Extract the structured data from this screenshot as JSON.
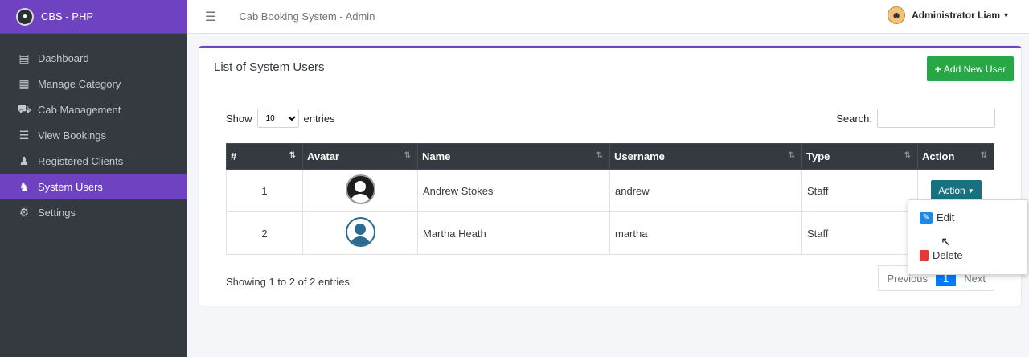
{
  "brand": {
    "name": "CBS - PHP"
  },
  "topbar": {
    "title": "Cab Booking System - Admin",
    "user": "Administrator Liam"
  },
  "sidebar": {
    "items": [
      {
        "label": "Dashboard",
        "icon": "dashboard-icon"
      },
      {
        "label": "Manage Category",
        "icon": "grid-icon"
      },
      {
        "label": "Cab Management",
        "icon": "car-icon"
      },
      {
        "label": "View Bookings",
        "icon": "list-icon"
      },
      {
        "label": "Registered Clients",
        "icon": "users-icon"
      },
      {
        "label": "System Users",
        "icon": "user-gear-icon",
        "active": true
      },
      {
        "label": "Settings",
        "icon": "cogs-icon"
      }
    ]
  },
  "card": {
    "title": "List of System Users",
    "add_button": "Add New User"
  },
  "table_controls": {
    "show_label": "Show",
    "entries_value": "10",
    "entries_label": "entries",
    "search_label": "Search:",
    "search_value": ""
  },
  "table": {
    "headers": [
      "#",
      "Avatar",
      "Name",
      "Username",
      "Type",
      "Action"
    ],
    "rows": [
      {
        "num": "1",
        "avatar": "dark",
        "name": "Andrew Stokes",
        "username": "andrew",
        "type": "Staff",
        "action": "Action"
      },
      {
        "num": "2",
        "avatar": "blue",
        "name": "Martha Heath",
        "username": "martha",
        "type": "Staff"
      }
    ]
  },
  "footer": {
    "info": "Showing 1 to 2 of 2 entries",
    "previous": "Previous",
    "current_page": "1",
    "next": "Next"
  },
  "dropdown": {
    "edit": "Edit",
    "delete": "Delete"
  },
  "colors": {
    "accent": "#6f42c1",
    "sidebar": "#343a40",
    "add": "#28a745",
    "action": "#17717e"
  }
}
